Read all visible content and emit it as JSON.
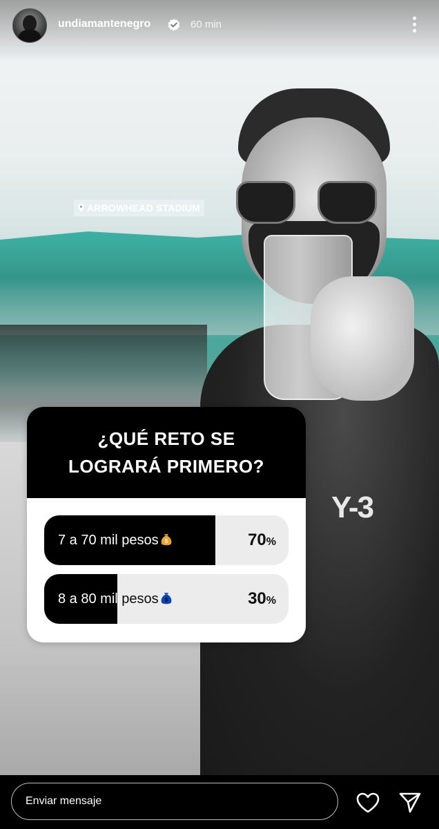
{
  "header": {
    "username": "undiamantenegro",
    "time": "60 min",
    "verified": true
  },
  "location_sticker": {
    "label": "ARROWHEAD STADIUM"
  },
  "poll": {
    "question": "¿QUÉ RETO SE LOGRARÁ PRIMERO?",
    "options": [
      {
        "label": "7 a 70 mil pesos",
        "emoji": "money-bag",
        "percent": "70",
        "percent_symbol": "%",
        "fill_fraction": 0.7
      },
      {
        "label": "8 a 80 mil pesos",
        "emoji": "money-bag",
        "percent": "30",
        "percent_symbol": "%",
        "fill_fraction": 0.3
      }
    ]
  },
  "footer": {
    "message_placeholder": "Enviar mensaje"
  },
  "colors": {
    "poll_fill": "#000000",
    "poll_track": "#ececec",
    "verified_badge": "#ffffff"
  }
}
